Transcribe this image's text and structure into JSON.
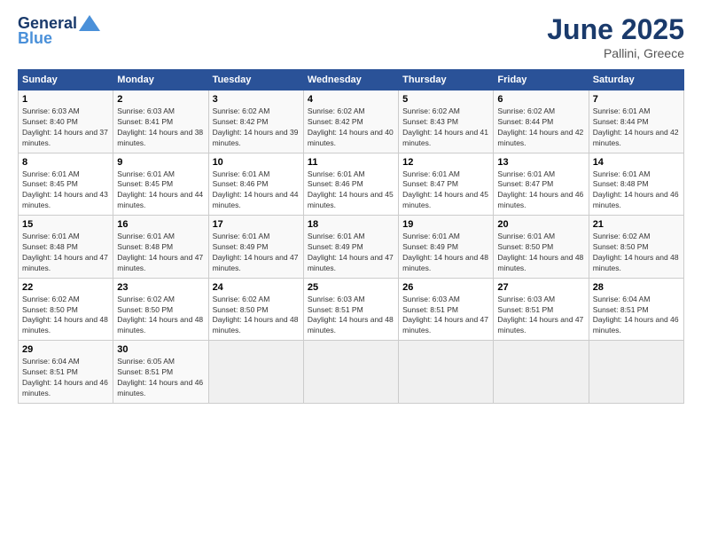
{
  "header": {
    "logo_general": "General",
    "logo_blue": "Blue",
    "month_title": "June 2025",
    "location": "Pallini, Greece"
  },
  "calendar": {
    "days_of_week": [
      "Sunday",
      "Monday",
      "Tuesday",
      "Wednesday",
      "Thursday",
      "Friday",
      "Saturday"
    ],
    "weeks": [
      [
        {
          "day": "",
          "empty": true
        },
        {
          "day": "",
          "empty": true
        },
        {
          "day": "",
          "empty": true
        },
        {
          "day": "",
          "empty": true
        },
        {
          "day": "",
          "empty": true
        },
        {
          "day": "",
          "empty": true
        },
        {
          "day": "",
          "empty": true
        }
      ],
      [
        {
          "day": "1",
          "sunrise": "6:03 AM",
          "sunset": "8:40 PM",
          "daylight": "14 hours and 37 minutes."
        },
        {
          "day": "2",
          "sunrise": "6:03 AM",
          "sunset": "8:41 PM",
          "daylight": "14 hours and 38 minutes."
        },
        {
          "day": "3",
          "sunrise": "6:02 AM",
          "sunset": "8:42 PM",
          "daylight": "14 hours and 39 minutes."
        },
        {
          "day": "4",
          "sunrise": "6:02 AM",
          "sunset": "8:42 PM",
          "daylight": "14 hours and 40 minutes."
        },
        {
          "day": "5",
          "sunrise": "6:02 AM",
          "sunset": "8:43 PM",
          "daylight": "14 hours and 41 minutes."
        },
        {
          "day": "6",
          "sunrise": "6:02 AM",
          "sunset": "8:44 PM",
          "daylight": "14 hours and 42 minutes."
        },
        {
          "day": "7",
          "sunrise": "6:01 AM",
          "sunset": "8:44 PM",
          "daylight": "14 hours and 42 minutes."
        }
      ],
      [
        {
          "day": "8",
          "sunrise": "6:01 AM",
          "sunset": "8:45 PM",
          "daylight": "14 hours and 43 minutes."
        },
        {
          "day": "9",
          "sunrise": "6:01 AM",
          "sunset": "8:45 PM",
          "daylight": "14 hours and 44 minutes."
        },
        {
          "day": "10",
          "sunrise": "6:01 AM",
          "sunset": "8:46 PM",
          "daylight": "14 hours and 44 minutes."
        },
        {
          "day": "11",
          "sunrise": "6:01 AM",
          "sunset": "8:46 PM",
          "daylight": "14 hours and 45 minutes."
        },
        {
          "day": "12",
          "sunrise": "6:01 AM",
          "sunset": "8:47 PM",
          "daylight": "14 hours and 45 minutes."
        },
        {
          "day": "13",
          "sunrise": "6:01 AM",
          "sunset": "8:47 PM",
          "daylight": "14 hours and 46 minutes."
        },
        {
          "day": "14",
          "sunrise": "6:01 AM",
          "sunset": "8:48 PM",
          "daylight": "14 hours and 46 minutes."
        }
      ],
      [
        {
          "day": "15",
          "sunrise": "6:01 AM",
          "sunset": "8:48 PM",
          "daylight": "14 hours and 47 minutes."
        },
        {
          "day": "16",
          "sunrise": "6:01 AM",
          "sunset": "8:48 PM",
          "daylight": "14 hours and 47 minutes."
        },
        {
          "day": "17",
          "sunrise": "6:01 AM",
          "sunset": "8:49 PM",
          "daylight": "14 hours and 47 minutes."
        },
        {
          "day": "18",
          "sunrise": "6:01 AM",
          "sunset": "8:49 PM",
          "daylight": "14 hours and 47 minutes."
        },
        {
          "day": "19",
          "sunrise": "6:01 AM",
          "sunset": "8:49 PM",
          "daylight": "14 hours and 48 minutes."
        },
        {
          "day": "20",
          "sunrise": "6:01 AM",
          "sunset": "8:50 PM",
          "daylight": "14 hours and 48 minutes."
        },
        {
          "day": "21",
          "sunrise": "6:02 AM",
          "sunset": "8:50 PM",
          "daylight": "14 hours and 48 minutes."
        }
      ],
      [
        {
          "day": "22",
          "sunrise": "6:02 AM",
          "sunset": "8:50 PM",
          "daylight": "14 hours and 48 minutes."
        },
        {
          "day": "23",
          "sunrise": "6:02 AM",
          "sunset": "8:50 PM",
          "daylight": "14 hours and 48 minutes."
        },
        {
          "day": "24",
          "sunrise": "6:02 AM",
          "sunset": "8:50 PM",
          "daylight": "14 hours and 48 minutes."
        },
        {
          "day": "25",
          "sunrise": "6:03 AM",
          "sunset": "8:51 PM",
          "daylight": "14 hours and 48 minutes."
        },
        {
          "day": "26",
          "sunrise": "6:03 AM",
          "sunset": "8:51 PM",
          "daylight": "14 hours and 47 minutes."
        },
        {
          "day": "27",
          "sunrise": "6:03 AM",
          "sunset": "8:51 PM",
          "daylight": "14 hours and 47 minutes."
        },
        {
          "day": "28",
          "sunrise": "6:04 AM",
          "sunset": "8:51 PM",
          "daylight": "14 hours and 46 minutes."
        }
      ],
      [
        {
          "day": "29",
          "sunrise": "6:04 AM",
          "sunset": "8:51 PM",
          "daylight": "14 hours and 46 minutes."
        },
        {
          "day": "30",
          "sunrise": "6:05 AM",
          "sunset": "8:51 PM",
          "daylight": "14 hours and 46 minutes."
        },
        {
          "day": "",
          "empty": true
        },
        {
          "day": "",
          "empty": true
        },
        {
          "day": "",
          "empty": true
        },
        {
          "day": "",
          "empty": true
        },
        {
          "day": "",
          "empty": true
        }
      ]
    ]
  }
}
